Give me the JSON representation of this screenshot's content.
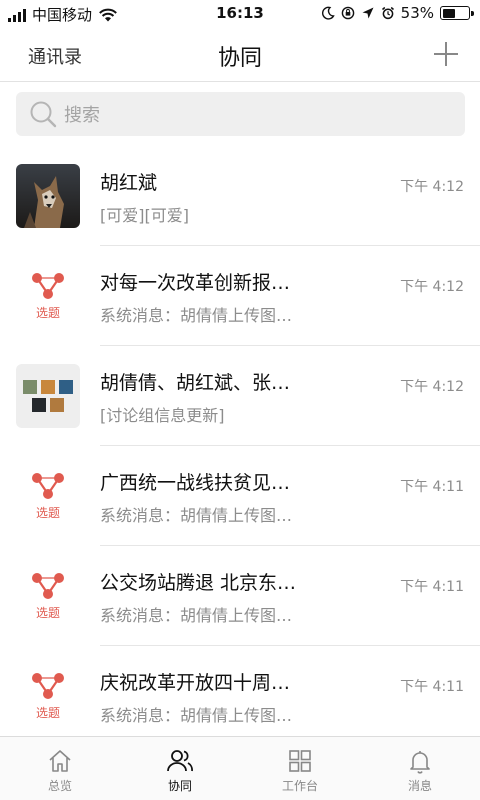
{
  "status": {
    "carrier": "中国移动",
    "time": "16:13",
    "battery": "53%",
    "battery_level": 0.53
  },
  "nav": {
    "left": "通讯录",
    "title": "协同",
    "right_icon": "plus-icon"
  },
  "search": {
    "placeholder": "搜索"
  },
  "colors": {
    "accent": "#e05a4f",
    "divider": "#e6e6e6",
    "search_bg": "#efefef"
  },
  "conversations": [
    {
      "avatar": "dog-photo",
      "title": "胡红斌",
      "subtitle": "[可爱][可爱]",
      "time": "下午 4:12"
    },
    {
      "avatar": "topic-icon",
      "avatar_label": "选题",
      "title": "对每一次改革创新报…",
      "subtitle": "系统消息：胡倩倩上传图…",
      "time": "下午 4:12"
    },
    {
      "avatar": "group-collage",
      "title": "胡倩倩、胡红斌、张…",
      "subtitle": "[讨论组信息更新]",
      "time": "下午 4:12"
    },
    {
      "avatar": "topic-icon",
      "avatar_label": "选题",
      "title": "广西统一战线扶贫见…",
      "subtitle": "系统消息：胡倩倩上传图…",
      "time": "下午 4:11"
    },
    {
      "avatar": "topic-icon",
      "avatar_label": "选题",
      "title": "公交场站腾退 北京东…",
      "subtitle": "系统消息：胡倩倩上传图…",
      "time": "下午 4:11"
    },
    {
      "avatar": "topic-icon",
      "avatar_label": "选题",
      "title": "庆祝改革开放四十周…",
      "subtitle": "系统消息：胡倩倩上传图…",
      "time": "下午 4:11"
    }
  ],
  "tabs": [
    {
      "label": "总览",
      "icon": "home-icon"
    },
    {
      "label": "协同",
      "icon": "contacts-icon",
      "active": true
    },
    {
      "label": "工作台",
      "icon": "grid-icon"
    },
    {
      "label": "消息",
      "icon": "bell-icon"
    }
  ]
}
